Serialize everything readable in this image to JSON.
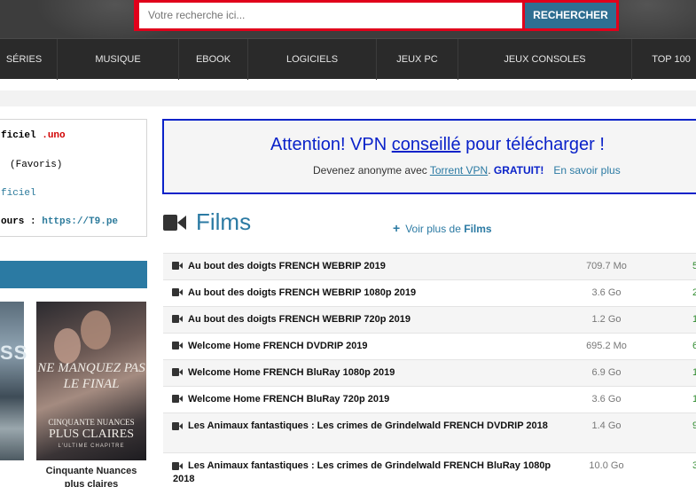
{
  "search": {
    "placeholder": "Votre recherche ici...",
    "button_label": "RECHERCHER"
  },
  "nav": {
    "items": [
      "SÉRIES",
      "MUSIQUE",
      "EBOOK",
      "LOGICIELS",
      "JEUX PC",
      "JEUX CONSOLES",
      "TOP 100"
    ]
  },
  "info": {
    "line1_prefix": "ficiel",
    "line1_suffix": ".uno",
    "line2": "(Favoris)",
    "line3": "ficiel",
    "line4_prefix": "ours : ",
    "line4_link": "https://T9.pe"
  },
  "vpn": {
    "title_1": "Attention! VPN ",
    "title_link": "conseillé",
    "title_2": " pour télécharger !",
    "sub_1": "Devenez anonyme avec ",
    "sub_link": "Torrent VPN",
    "sub_2": ". ",
    "sub_free": "GRATUIT!",
    "sub_more": "En savoir plus"
  },
  "films": {
    "title": "Films",
    "voir_plus_prefix": "Voir plus de ",
    "voir_plus_bold": "Films"
  },
  "sidebar": {
    "poster1_text": "SS",
    "poster2_t1": "NE MANQUEZ PAS LE FINAL",
    "poster2_t2": "CINQUANTE NUANCES",
    "poster2_t3": "PLUS CLAIRES",
    "poster2_t4": "L'ULTIME CHAPITRE",
    "caption": "Cinquante Nuances plus claires"
  },
  "torrents": [
    {
      "name": "Au bout des doigts FRENCH WEBRIP 2019",
      "size": "709.7 Mo",
      "seed": "5"
    },
    {
      "name": "Au bout des doigts FRENCH WEBRIP 1080p 2019",
      "size": "3.6 Go",
      "seed": "2"
    },
    {
      "name": "Au bout des doigts FRENCH WEBRIP 720p 2019",
      "size": "1.2 Go",
      "seed": "1"
    },
    {
      "name": "Welcome Home FRENCH DVDRIP 2019",
      "size": "695.2 Mo",
      "seed": "6"
    },
    {
      "name": "Welcome Home FRENCH BluRay 1080p 2019",
      "size": "6.9 Go",
      "seed": "1"
    },
    {
      "name": "Welcome Home FRENCH BluRay 720p 2019",
      "size": "3.6 Go",
      "seed": "1"
    },
    {
      "name": "Les Animaux fantastiques : Les crimes de Grindelwald FRENCH DVDRIP 2018",
      "size": "1.4 Go",
      "seed": "9"
    },
    {
      "name": "Les Animaux fantastiques : Les crimes de Grindelwald FRENCH BluRay 1080p 2018",
      "size": "10.0 Go",
      "seed": "3"
    }
  ],
  "colors": {
    "accent": "#2b7aa3",
    "search_border": "#e0001b",
    "vpn_blue": "#0a22c9",
    "seed_green": "#2e8b2e"
  }
}
